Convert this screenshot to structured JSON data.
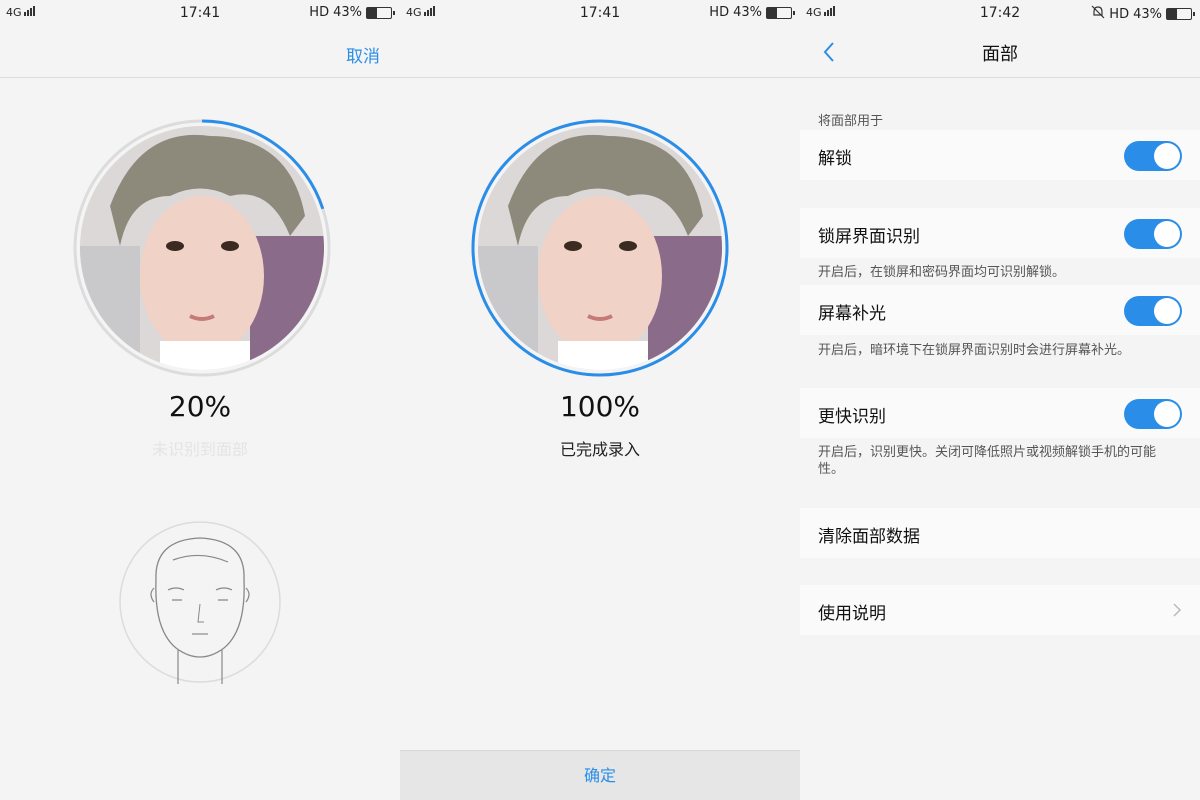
{
  "status_bars": [
    {
      "network": "4G",
      "time": "17:41",
      "hd": "HD",
      "battery": "43%",
      "battery_level": 0.43
    },
    {
      "network": "4G",
      "time": "17:41",
      "hd": "HD",
      "battery": "43%",
      "battery_level": 0.43
    },
    {
      "network": "4G",
      "time": "17:42",
      "hd": "HD",
      "battery": "43%",
      "battery_level": 0.43
    }
  ],
  "scan_screen": {
    "cancel_label": "取消",
    "progress_text": "20%",
    "progress_value": 0.2,
    "hint": "未识别到面部"
  },
  "complete_screen": {
    "progress_text": "100%",
    "progress_value": 1.0,
    "status": "已完成录入",
    "confirm_label": "确定"
  },
  "settings_screen": {
    "title": "面部",
    "section_label": "将面部用于",
    "unlock": {
      "label": "解锁",
      "enabled": true
    },
    "lockscreen_recognition": {
      "label": "锁屏界面识别",
      "enabled": true,
      "desc": "开启后，在锁屏和密码界面均可识别解锁。"
    },
    "screen_fill_light": {
      "label": "屏幕补光",
      "enabled": true,
      "desc": "开启后，暗环境下在锁屏界面识别时会进行屏幕补光。"
    },
    "faster_recognition": {
      "label": "更快识别",
      "enabled": true,
      "desc": "开启后，识别更快。关闭可降低照片或视频解锁手机的可能性。"
    },
    "clear_data_label": "清除面部数据",
    "instructions_label": "使用说明"
  },
  "colors": {
    "accent": "#2a8ee8",
    "hint_gray": "#e4e4e4",
    "ring_gray": "#dcdcdc"
  }
}
